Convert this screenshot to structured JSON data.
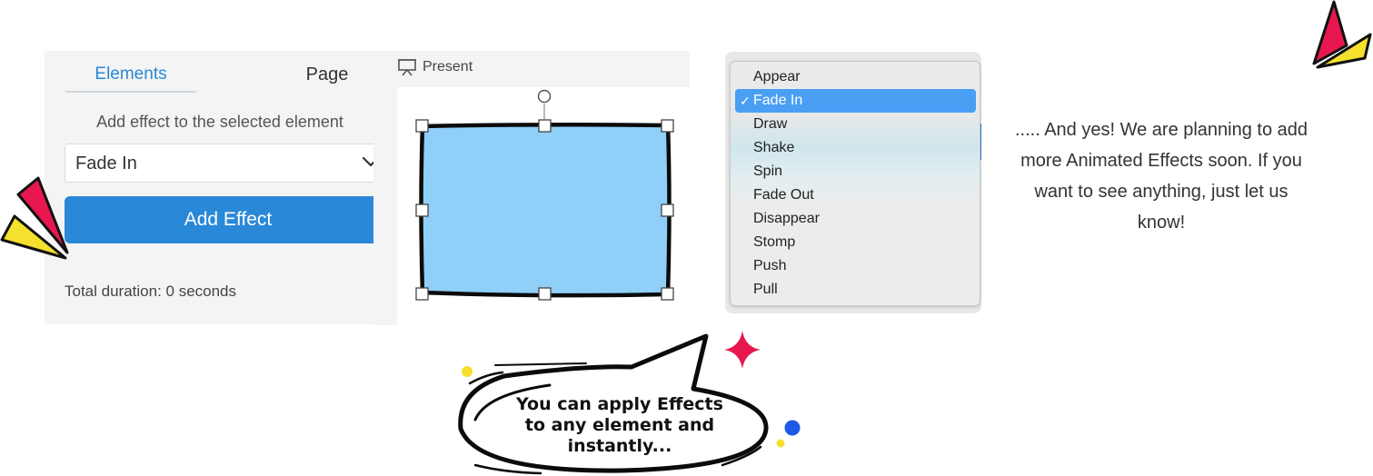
{
  "tabs": {
    "elements": "Elements",
    "page": "Page"
  },
  "effect_panel": {
    "hint": "Add effect to the selected element",
    "selected_effect": "Fade In",
    "add_button": "Add Effect",
    "total_duration": "Total duration: 0 seconds"
  },
  "canvas": {
    "present_label": "Present",
    "shape_fill": "#90cff8"
  },
  "menu": {
    "items": [
      "Appear",
      "Fade In",
      "Draw",
      "Shake",
      "Spin",
      "Fade Out",
      "Disappear",
      "Stomp",
      "Push",
      "Pull"
    ],
    "selected": "Fade In",
    "check": "✓"
  },
  "info_text": "..... And yes! We are planning to add more Animated Effects soon. If you want to see anything, just let us know!",
  "bubble_text": "You can apply Effects to any element and instantly...",
  "colors": {
    "accent": "#2a88d8",
    "selection": "#4a9ff5",
    "burst_red": "#e8174f",
    "burst_yellow": "#f5e02d",
    "dot_blue": "#1e58e8"
  }
}
